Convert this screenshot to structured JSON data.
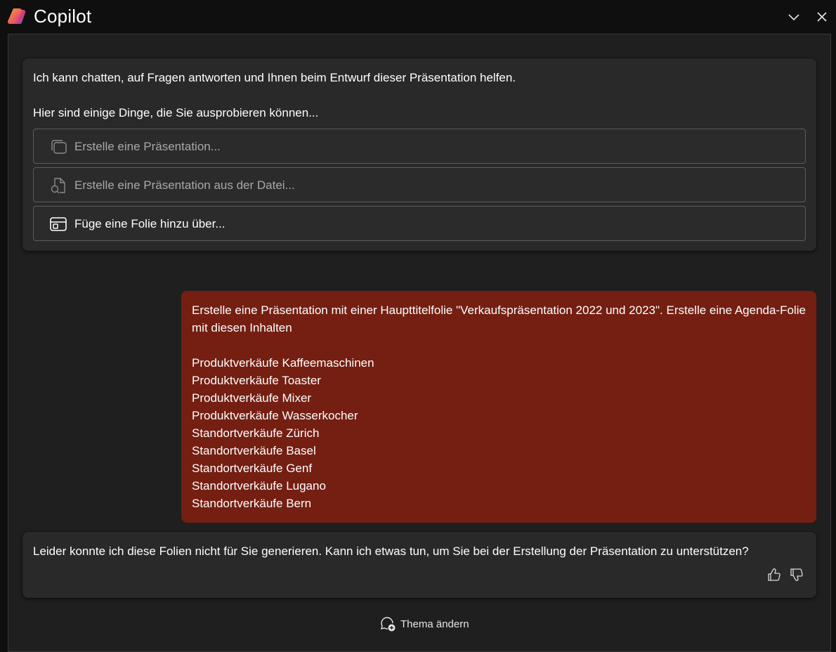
{
  "app": {
    "title": "Copilot",
    "logo_icon": "copilot-logo-icon",
    "controls": {
      "collapse_icon": "chevron-down-icon",
      "close_icon": "close-icon"
    }
  },
  "intro_card": {
    "line1": "Ich kann chatten, auf Fragen antworten und Ihnen beim Entwurf dieser Präsentation helfen.",
    "line2": "Hier sind einige Dinge, die Sie ausprobieren können...",
    "suggestions": [
      {
        "label": "Erstelle eine Präsentation...",
        "icon": "slides-stack-icon",
        "enabled": false
      },
      {
        "label": "Erstelle eine Präsentation aus der Datei...",
        "icon": "file-search-icon",
        "enabled": false
      },
      {
        "label": "Füge eine Folie hinzu über...",
        "icon": "slide-layout-icon",
        "enabled": true
      }
    ]
  },
  "user_message": {
    "intro": "Erstelle eine Präsentation mit einer Haupttitelfolie \"Verkaufspräsentation 2022 und 2023\". Erstelle eine Agenda-Folie mit diesen Inhalten",
    "items": [
      "Produktverkäufe Kaffeemaschinen",
      "Produktverkäufe Toaster",
      "Produktverkäufe Mixer",
      "Produktverkäufe Wasserkocher",
      "Standortverkäufe Zürich",
      "Standortverkäufe Basel",
      "Standortverkäufe Genf",
      "Standortverkäufe Lugano",
      "Standortverkäufe Bern"
    ],
    "bubble_color": "#741f12"
  },
  "reply_card": {
    "text": "Leider konnte ich diese Folien nicht für Sie generieren. Kann ich etwas tun, um Sie bei der Erstellung der Präsentation zu unterstützen?",
    "feedback": {
      "like_icon": "thumbs-up-icon",
      "dislike_icon": "thumbs-down-icon"
    }
  },
  "footer": {
    "change_topic_label": "Thema ändern",
    "change_topic_icon": "new-chat-icon"
  }
}
